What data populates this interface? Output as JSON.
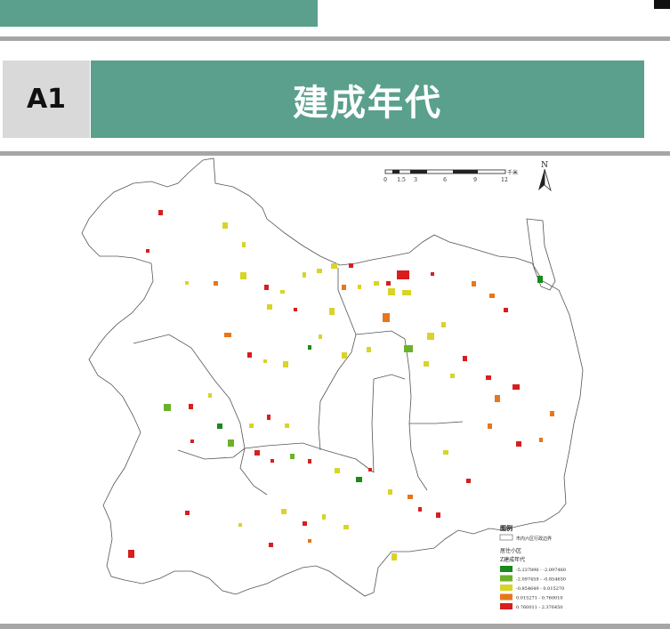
{
  "header": {
    "badge": "A1",
    "title": "建成年代"
  },
  "map": {
    "scale_unit": "千米",
    "scale_ticks": [
      "0",
      "1.5",
      "3",
      "6",
      "9",
      "12"
    ],
    "north_label": "N",
    "legend": {
      "title": "图例",
      "boundary_label": "市内六区行政边界",
      "layer_label": "居住小区",
      "field_label": "Z建成年代",
      "classes": [
        {
          "label": "-5.237896 - -2.097460",
          "color": "#1a8a1a"
        },
        {
          "label": "-2.097459 - -0.854650",
          "color": "#6cb12a"
        },
        {
          "label": "-0.854649 - 0.015270",
          "color": "#d8d428"
        },
        {
          "label": "0.015271 - 0.760010",
          "color": "#e8761a"
        },
        {
          "label": "0.760011 - 2.376450",
          "color": "#d81e1e"
        }
      ]
    }
  }
}
